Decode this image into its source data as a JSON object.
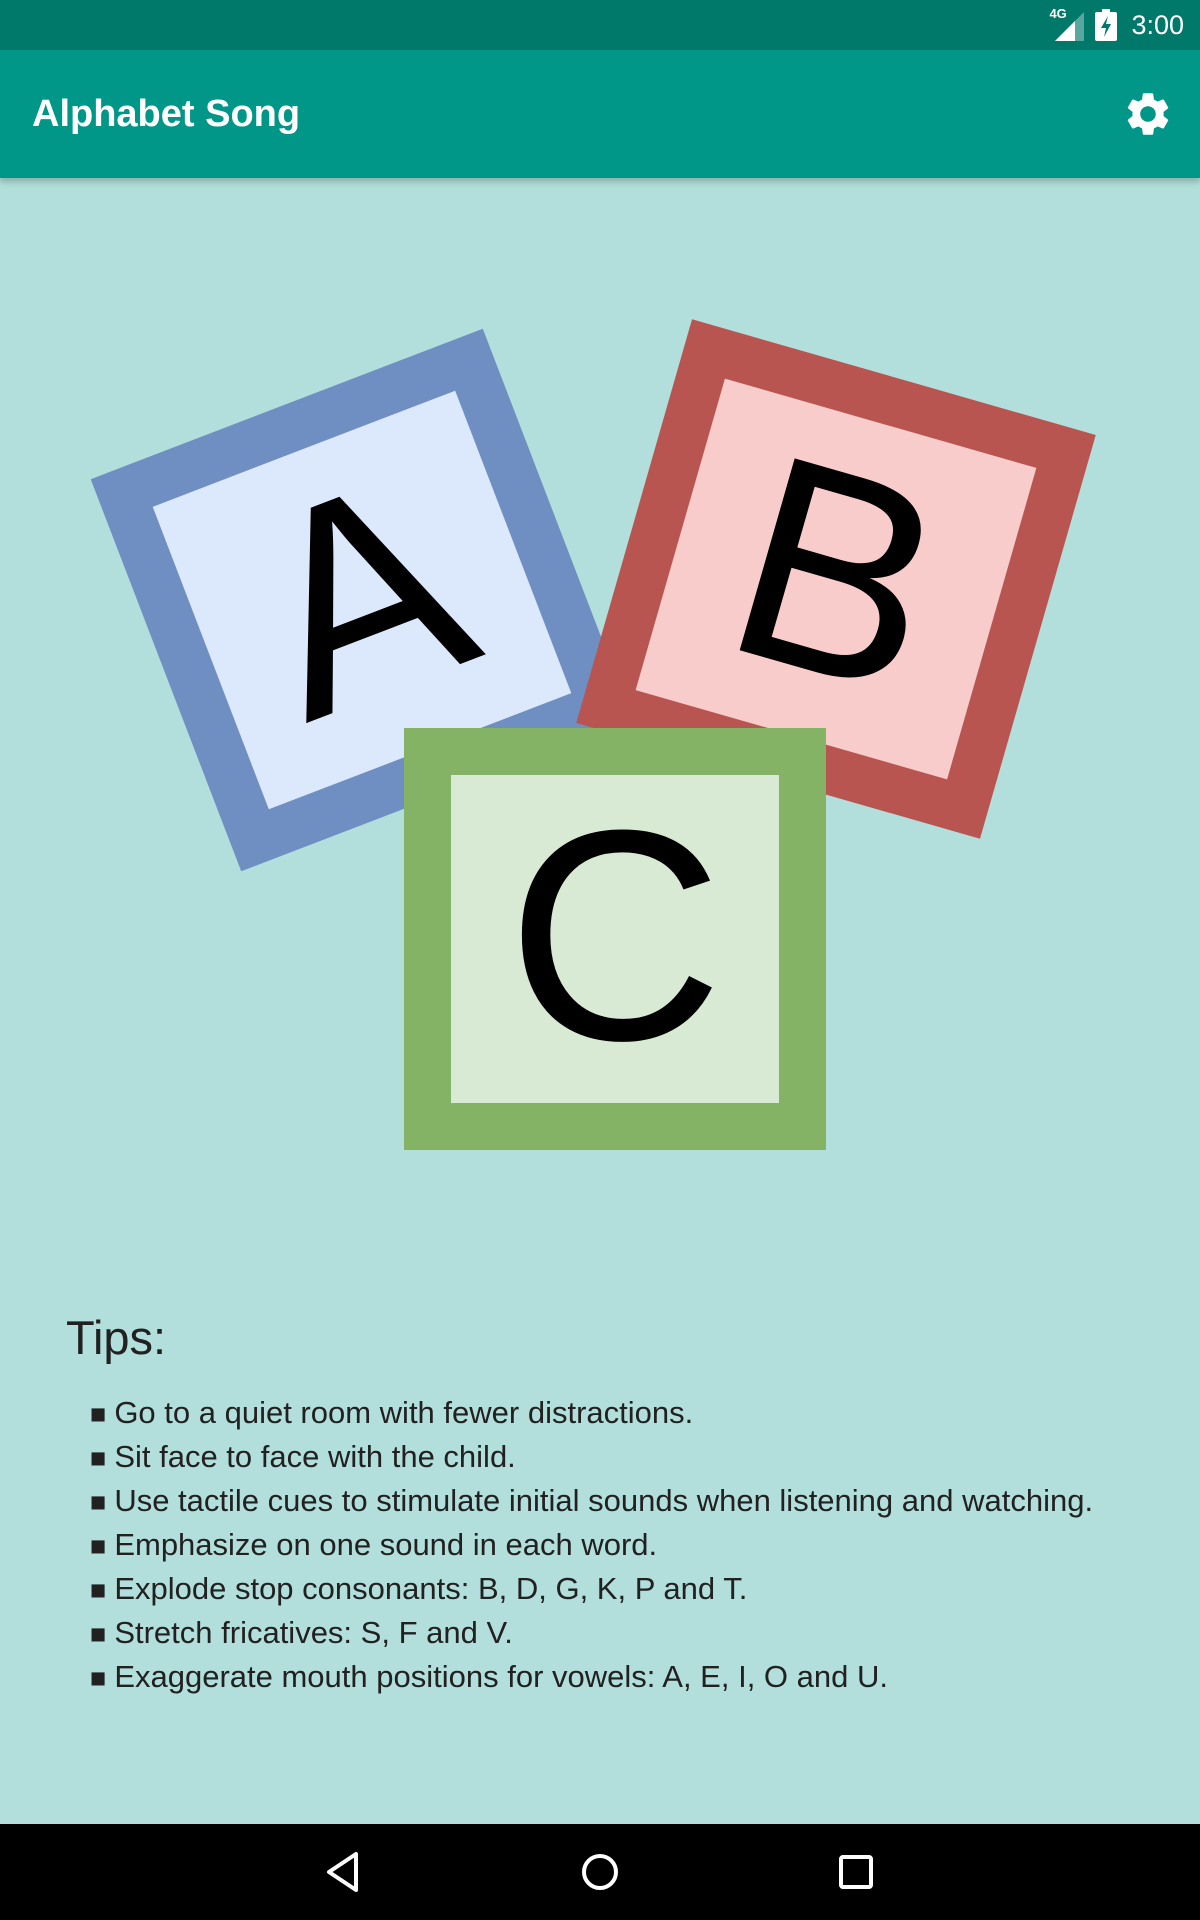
{
  "status_bar": {
    "network": "4G",
    "time": "3:00"
  },
  "app_bar": {
    "title": "Alphabet Song",
    "settings_icon": "gear-icon"
  },
  "blocks": [
    {
      "letter": "A",
      "border_color": "#6f8fc2",
      "face_color": "#dce8fb"
    },
    {
      "letter": "B",
      "border_color": "#b85550",
      "face_color": "#f8cccb"
    },
    {
      "letter": "C",
      "border_color": "#84b366",
      "face_color": "#d8e9d4"
    }
  ],
  "tips": {
    "title": "Tips:",
    "bullet": "■",
    "items": [
      "Go to a quiet room with fewer distractions.",
      "Sit face to face with the child.",
      "Use tactile cues to stimulate initial sounds when listening and watching.",
      "Emphasize on one sound in each word.",
      "Explode stop consonants: B, D, G, K, P and T.",
      "Stretch fricatives: S, F and V.",
      "Exaggerate mouth positions for vowels: A, E, I, O and U."
    ]
  },
  "nav_bar": {
    "back_icon": "back-triangle-icon",
    "home_icon": "home-circle-icon",
    "recents_icon": "recents-square-icon"
  },
  "colors": {
    "status_bar": "#00796b",
    "app_bar": "#009688",
    "background": "#b2dfdb",
    "text": "#212121",
    "nav_bar": "#000000"
  }
}
